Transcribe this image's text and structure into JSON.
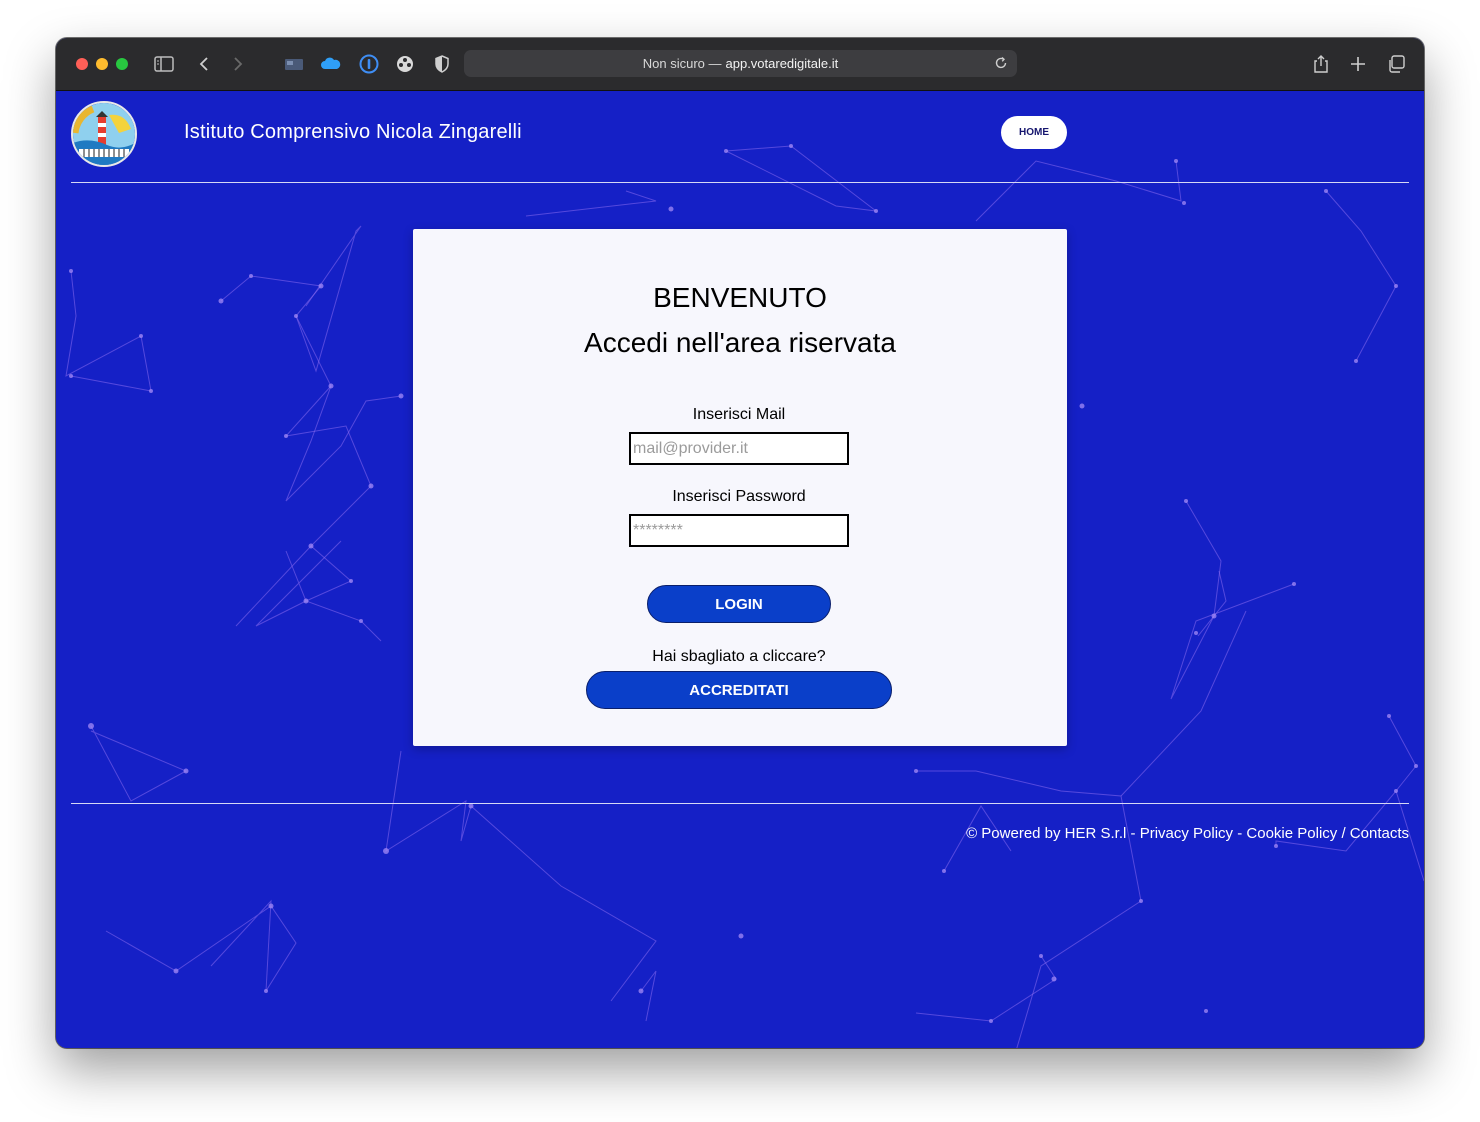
{
  "browser": {
    "url_prefix": "Non sicuro —",
    "url_host": "app.votaredigitale.it"
  },
  "header": {
    "title": "Istituto Comprensivo Nicola Zingarelli",
    "home_label": "HOME"
  },
  "card": {
    "title": "BENVENUTO",
    "subtitle": "Accedi nell'area riservata",
    "mail_label": "Inserisci Mail",
    "mail_placeholder": "mail@provider.it",
    "password_label": "Inserisci Password",
    "password_placeholder": "********",
    "login_label": "LOGIN",
    "wrong_text": "Hai sbagliato a cliccare?",
    "register_label": "ACCREDITATI"
  },
  "footer": {
    "powered": "© Powered by HER S.r.l",
    "sep1": " - ",
    "privacy": "Privacy Policy",
    "sep2": " - ",
    "cookie": "Cookie Policy",
    "sep3": " / ",
    "contacts": "Contacts"
  },
  "colors": {
    "page_background": "#1520c6",
    "button": "#0a3fc9",
    "network_lines": "#8a6cf0"
  },
  "icons": [
    "sidebar-icon",
    "back-icon",
    "forward-icon",
    "tab-overview-icon",
    "cloud-icon",
    "password-manager-icon",
    "extension-icon",
    "privacy-shield-icon",
    "reload-icon",
    "share-icon",
    "new-tab-icon",
    "tabs-icon"
  ]
}
